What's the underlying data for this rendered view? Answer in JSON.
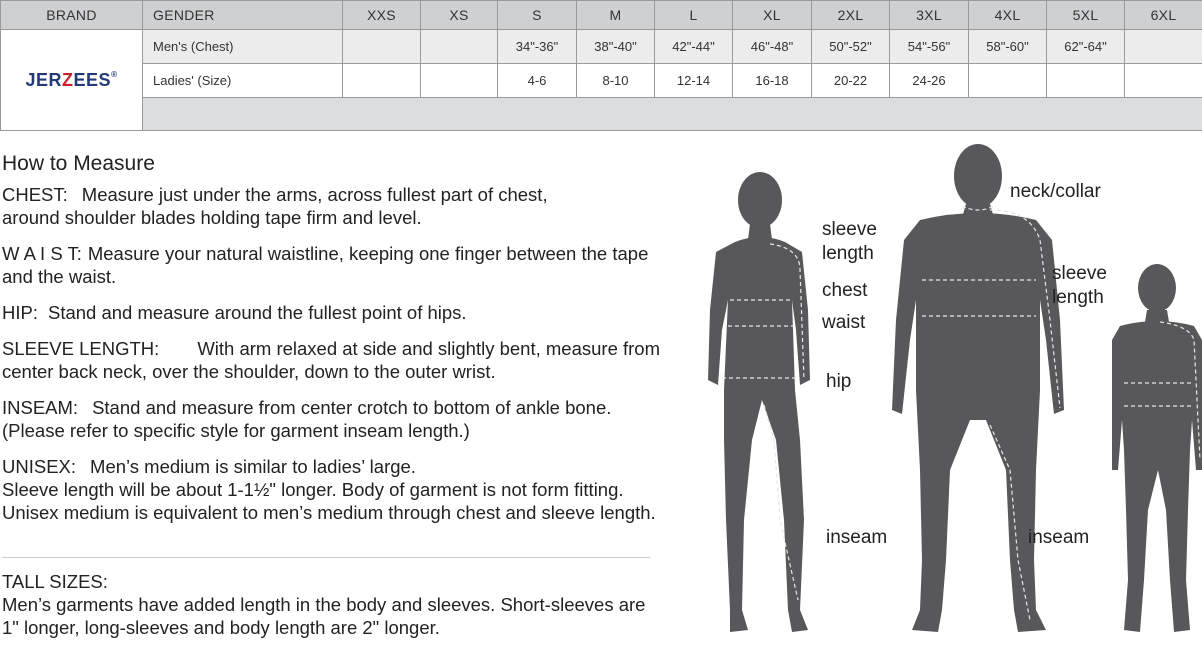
{
  "table": {
    "headers": [
      "BRAND",
      "GENDER",
      "XXS",
      "XS",
      "S",
      "M",
      "L",
      "XL",
      "2XL",
      "3XL",
      "4XL",
      "5XL",
      "6XL"
    ],
    "brand": {
      "name_part1": "JER",
      "name_z": "Z",
      "name_part2": "EES",
      "reg": "®"
    },
    "rows": [
      {
        "gender": "Men's (Chest)",
        "values": [
          "",
          "",
          "34\"-36\"",
          "38\"-40\"",
          "42\"-44\"",
          "46\"-48\"",
          "50\"-52\"",
          "54\"-56\"",
          "58\"-60\"",
          "62\"-64\"",
          ""
        ]
      },
      {
        "gender": "Ladies' (Size)",
        "values": [
          "",
          "",
          "4-6",
          "8-10",
          "12-14",
          "16-18",
          "20-22",
          "24-26",
          "",
          "",
          ""
        ]
      }
    ]
  },
  "measure": {
    "title": "How to Measure",
    "chest_term": "CHEST:",
    "chest_line1": "Measure just under the arms, across fullest part of chest,",
    "chest_line2": "around shoulder blades holding tape firm and level.",
    "waist_term": "W A I S T:",
    "waist_line1": "Measure your natural waistline, keeping one finger between the tape",
    "waist_line2": "and the waist.",
    "hip_term": "HIP:",
    "hip_text": "Stand and measure around the fullest point of hips.",
    "sleeve_term": "SLEEVE LENGTH:",
    "sleeve_line1": "With arm relaxed at side and slightly bent, measure from",
    "sleeve_line2": "center back neck, over the shoulder, down to the outer wrist.",
    "inseam_term": "INSEAM:",
    "inseam_line1": "Stand and measure from center crotch to bottom of ankle bone.",
    "inseam_line2": "(Please refer to specific style for garment inseam length.)",
    "unisex_term": "UNISEX:",
    "unisex_line1": "Men’s medium is similar to ladies’ large.",
    "unisex_line2": "Sleeve length will be about 1-1½\" longer. Body of garment is not form fitting.",
    "unisex_line3": "Unisex medium is equivalent to men’s medium through chest and sleeve length."
  },
  "tall": {
    "title": "TALL SIZES:",
    "line1": "Men’s garments have added length in the body and sleeves. Short-sleeves are",
    "line2": "1\" longer, long-sleeves and body length are 2\" longer."
  },
  "figure_labels": {
    "sleeve_length_w_1": "sleeve",
    "sleeve_length_w_2": "length",
    "chest": "chest",
    "waist": "waist",
    "hip": "hip",
    "inseam_w": "inseam",
    "neck_collar": "neck/collar",
    "sleeve_length_m_1": "sleeve",
    "sleeve_length_m_2": "length",
    "inseam_m": "inseam"
  },
  "colors": {
    "header_bg": "#cfd0d2",
    "silhouette": "#58585a",
    "brand_blue": "#233a7a",
    "brand_red": "#c8202f"
  }
}
